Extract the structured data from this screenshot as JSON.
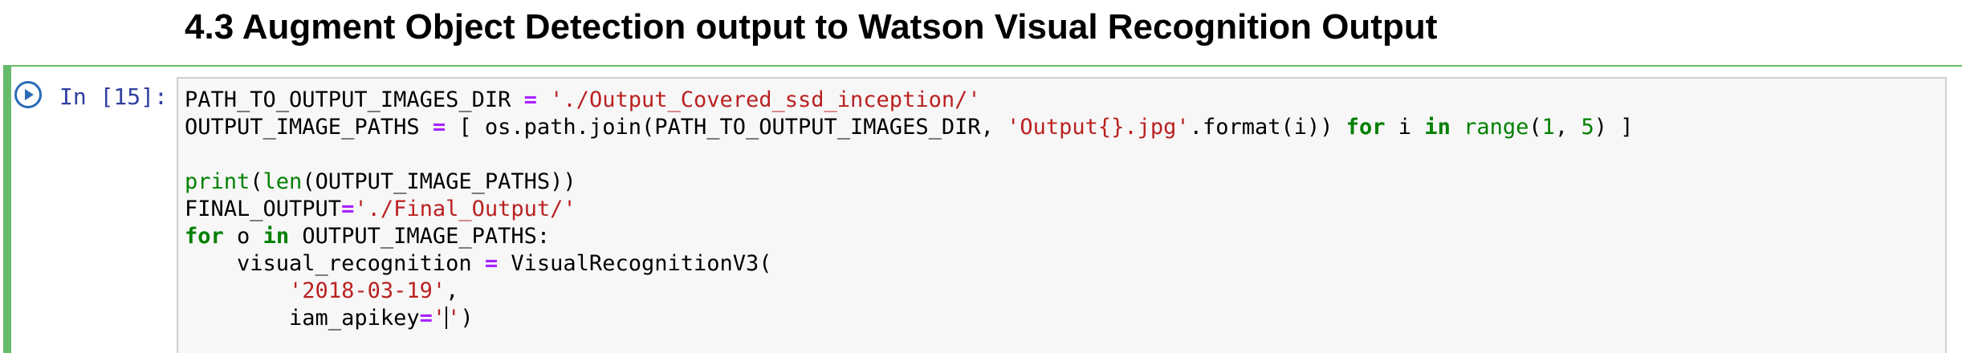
{
  "heading": "4.3 Augment Object Detection output to Watson Visual Recognition Output",
  "cell": {
    "prompt": "In [15]:",
    "run_icon": "run-cell-icon",
    "accent_color": "#66bb6a",
    "lines": [
      [
        {
          "text": "PATH_TO_OUTPUT_IMAGES_DIR ",
          "type": "plain"
        },
        {
          "text": "=",
          "type": "op"
        },
        {
          "text": " ",
          "type": "plain"
        },
        {
          "text": "'./Output_Covered_ssd_inception/'",
          "type": "str"
        }
      ],
      [
        {
          "text": "OUTPUT_IMAGE_PATHS ",
          "type": "plain"
        },
        {
          "text": "=",
          "type": "op"
        },
        {
          "text": " [ os.path.join(PATH_TO_OUTPUT_IMAGES_DIR, ",
          "type": "plain"
        },
        {
          "text": "'Output{}.jpg'",
          "type": "str"
        },
        {
          "text": ".format(i)) ",
          "type": "plain"
        },
        {
          "text": "for",
          "type": "kw"
        },
        {
          "text": " i ",
          "type": "plain"
        },
        {
          "text": "in",
          "type": "kw"
        },
        {
          "text": " ",
          "type": "plain"
        },
        {
          "text": "range",
          "type": "bi"
        },
        {
          "text": "(",
          "type": "plain"
        },
        {
          "text": "1",
          "type": "num"
        },
        {
          "text": ", ",
          "type": "plain"
        },
        {
          "text": "5",
          "type": "num"
        },
        {
          "text": ") ]",
          "type": "plain"
        }
      ],
      [],
      [
        {
          "text": "print",
          "type": "bi"
        },
        {
          "text": "(",
          "type": "plain"
        },
        {
          "text": "len",
          "type": "bi"
        },
        {
          "text": "(OUTPUT_IMAGE_PATHS))",
          "type": "plain"
        }
      ],
      [
        {
          "text": "FINAL_OUTPUT",
          "type": "plain"
        },
        {
          "text": "=",
          "type": "op"
        },
        {
          "text": "'./Final_Output/'",
          "type": "str"
        }
      ],
      [
        {
          "text": "for",
          "type": "kw"
        },
        {
          "text": " o ",
          "type": "plain"
        },
        {
          "text": "in",
          "type": "kw"
        },
        {
          "text": " OUTPUT_IMAGE_PATHS:",
          "type": "plain"
        }
      ],
      [
        {
          "text": "    visual_recognition ",
          "type": "plain"
        },
        {
          "text": "=",
          "type": "op"
        },
        {
          "text": " VisualRecognitionV3(",
          "type": "plain"
        }
      ],
      [
        {
          "text": "        ",
          "type": "plain"
        },
        {
          "text": "'2018-03-19'",
          "type": "str"
        },
        {
          "text": ",",
          "type": "plain"
        }
      ],
      [
        {
          "text": "        iam_apikey",
          "type": "plain"
        },
        {
          "text": "=",
          "type": "op"
        },
        {
          "text": "'",
          "type": "str"
        },
        {
          "text": "",
          "type": "cursor"
        },
        {
          "text": "'",
          "type": "str"
        },
        {
          "text": ")",
          "type": "plain"
        }
      ]
    ]
  }
}
